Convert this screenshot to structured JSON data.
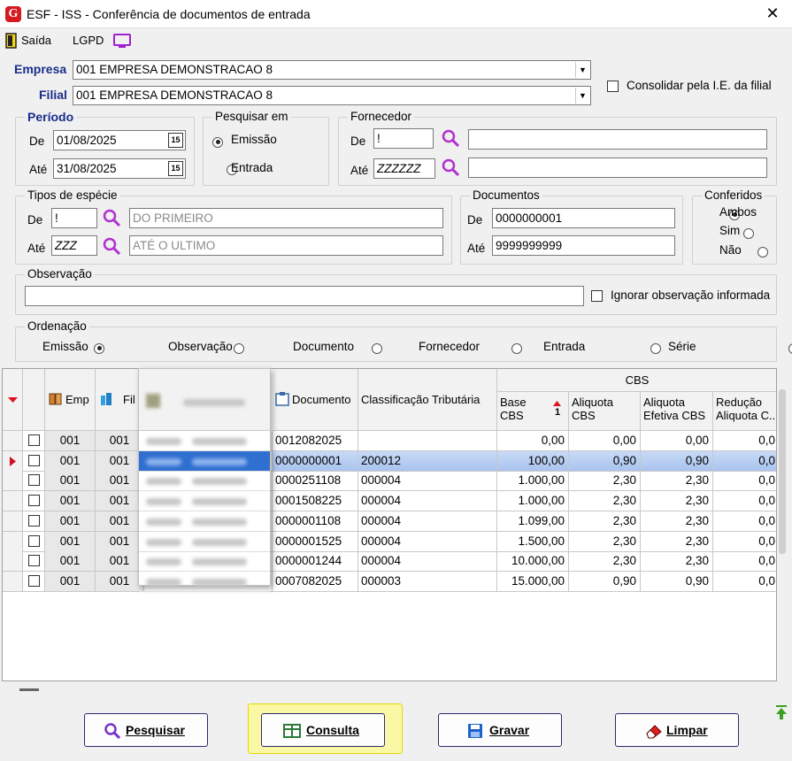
{
  "window": {
    "title": "ESF - ISS - Conferência de documentos de entrada",
    "logo_letter": "G",
    "close": "✕"
  },
  "toolbar": {
    "exit_label": "Saída",
    "lgpd_label": "LGPD"
  },
  "empresa": {
    "label": "Empresa",
    "value": "001 EMPRESA DEMONSTRACAO 8"
  },
  "filial": {
    "label": "Filial",
    "value": "001 EMPRESA DEMONSTRACAO 8"
  },
  "consolidar": {
    "label": "Consolidar pela I.E. da filial",
    "checked": false
  },
  "periodo": {
    "title": "Período",
    "de_label": "De",
    "de_value": "01/08/2025",
    "ate_label": "Até",
    "ate_value": "31/08/2025",
    "cal_icon": "15"
  },
  "pesquisar_em": {
    "title": "Pesquisar em",
    "opt1": "Emissão",
    "opt2": "Entrada",
    "selected": "Emissão"
  },
  "fornecedor": {
    "title": "Fornecedor",
    "de_label": "De",
    "de_value": "!",
    "de_name": "",
    "ate_label": "Até",
    "ate_value": "ZZZZZZ",
    "ate_name": ""
  },
  "tipos": {
    "title": "Tipos de espécie",
    "de_label": "De",
    "de_value": "!",
    "de_desc": "DO PRIMEIRO",
    "ate_label": "Até",
    "ate_value": "ZZZ",
    "ate_desc": "ATÉ O ULTIMO"
  },
  "documentos": {
    "title": "Documentos",
    "de_label": "De",
    "de_value": "0000000001",
    "ate_label": "Até",
    "ate_value": "9999999999"
  },
  "conferidos": {
    "title": "Conferidos",
    "opt1": "Ambos",
    "opt2": "Sim",
    "opt3": "Não",
    "selected": "Ambos"
  },
  "observacao": {
    "title": "Observação",
    "value": "",
    "ignore_label": "Ignorar observação informada"
  },
  "ordenacao": {
    "title": "Ordenação",
    "opts": [
      "Emissão",
      "Observação",
      "Documento",
      "Fornecedor",
      "Entrada",
      "Série"
    ],
    "selected": "Emissão"
  },
  "grid": {
    "group_header": "CBS",
    "columns": {
      "emp": "Emp",
      "fil": "Fil",
      "fornecedor": "Fornecedor",
      "documento": "Documento",
      "classificacao": "Classificação Tributária",
      "base": "Base CBS",
      "base_sort": "1",
      "aliquota": "Aliquota CBS",
      "aliq_efetiva": "Aliquota Efetiva CBS",
      "reducao": "Redução Aliquota C..."
    },
    "rows": [
      {
        "emp": "001",
        "fil": "001",
        "documento": "0012082025",
        "classificacao": "",
        "base": "0,00",
        "aliquota": "0,00",
        "aliq_efetiva": "0,00",
        "reducao": "0,0",
        "current": false
      },
      {
        "emp": "001",
        "fil": "001",
        "documento": "0000000001",
        "classificacao": "200012",
        "base": "100,00",
        "aliquota": "0,90",
        "aliq_efetiva": "0,90",
        "reducao": "0,0",
        "current": true
      },
      {
        "emp": "001",
        "fil": "001",
        "documento": "0000251108",
        "classificacao": "000004",
        "base": "1.000,00",
        "aliquota": "2,30",
        "aliq_efetiva": "2,30",
        "reducao": "0,0",
        "current": false
      },
      {
        "emp": "001",
        "fil": "001",
        "documento": "0001508225",
        "classificacao": "000004",
        "base": "1.000,00",
        "aliquota": "2,30",
        "aliq_efetiva": "2,30",
        "reducao": "0,0",
        "current": false
      },
      {
        "emp": "001",
        "fil": "001",
        "documento": "0000001108",
        "classificacao": "000004",
        "base": "1.099,00",
        "aliquota": "2,30",
        "aliq_efetiva": "2,30",
        "reducao": "0,0",
        "current": false
      },
      {
        "emp": "001",
        "fil": "001",
        "documento": "0000001525",
        "classificacao": "000004",
        "base": "1.500,00",
        "aliquota": "2,30",
        "aliq_efetiva": "2,30",
        "reducao": "0,0",
        "current": false
      },
      {
        "emp": "001",
        "fil": "001",
        "documento": "0000001244",
        "classificacao": "000004",
        "base": "10.000,00",
        "aliquota": "2,30",
        "aliq_efetiva": "2,30",
        "reducao": "0,0",
        "current": false
      },
      {
        "emp": "001",
        "fil": "001",
        "documento": "0007082025",
        "classificacao": "000003",
        "base": "15.000,00",
        "aliquota": "0,90",
        "aliq_efetiva": "0,90",
        "reducao": "0,0",
        "current": false
      }
    ]
  },
  "buttons": {
    "pesquisar": "Pesquisar",
    "consulta": "Consulta",
    "gravar": "Gravar",
    "limpar": "Limpar"
  }
}
